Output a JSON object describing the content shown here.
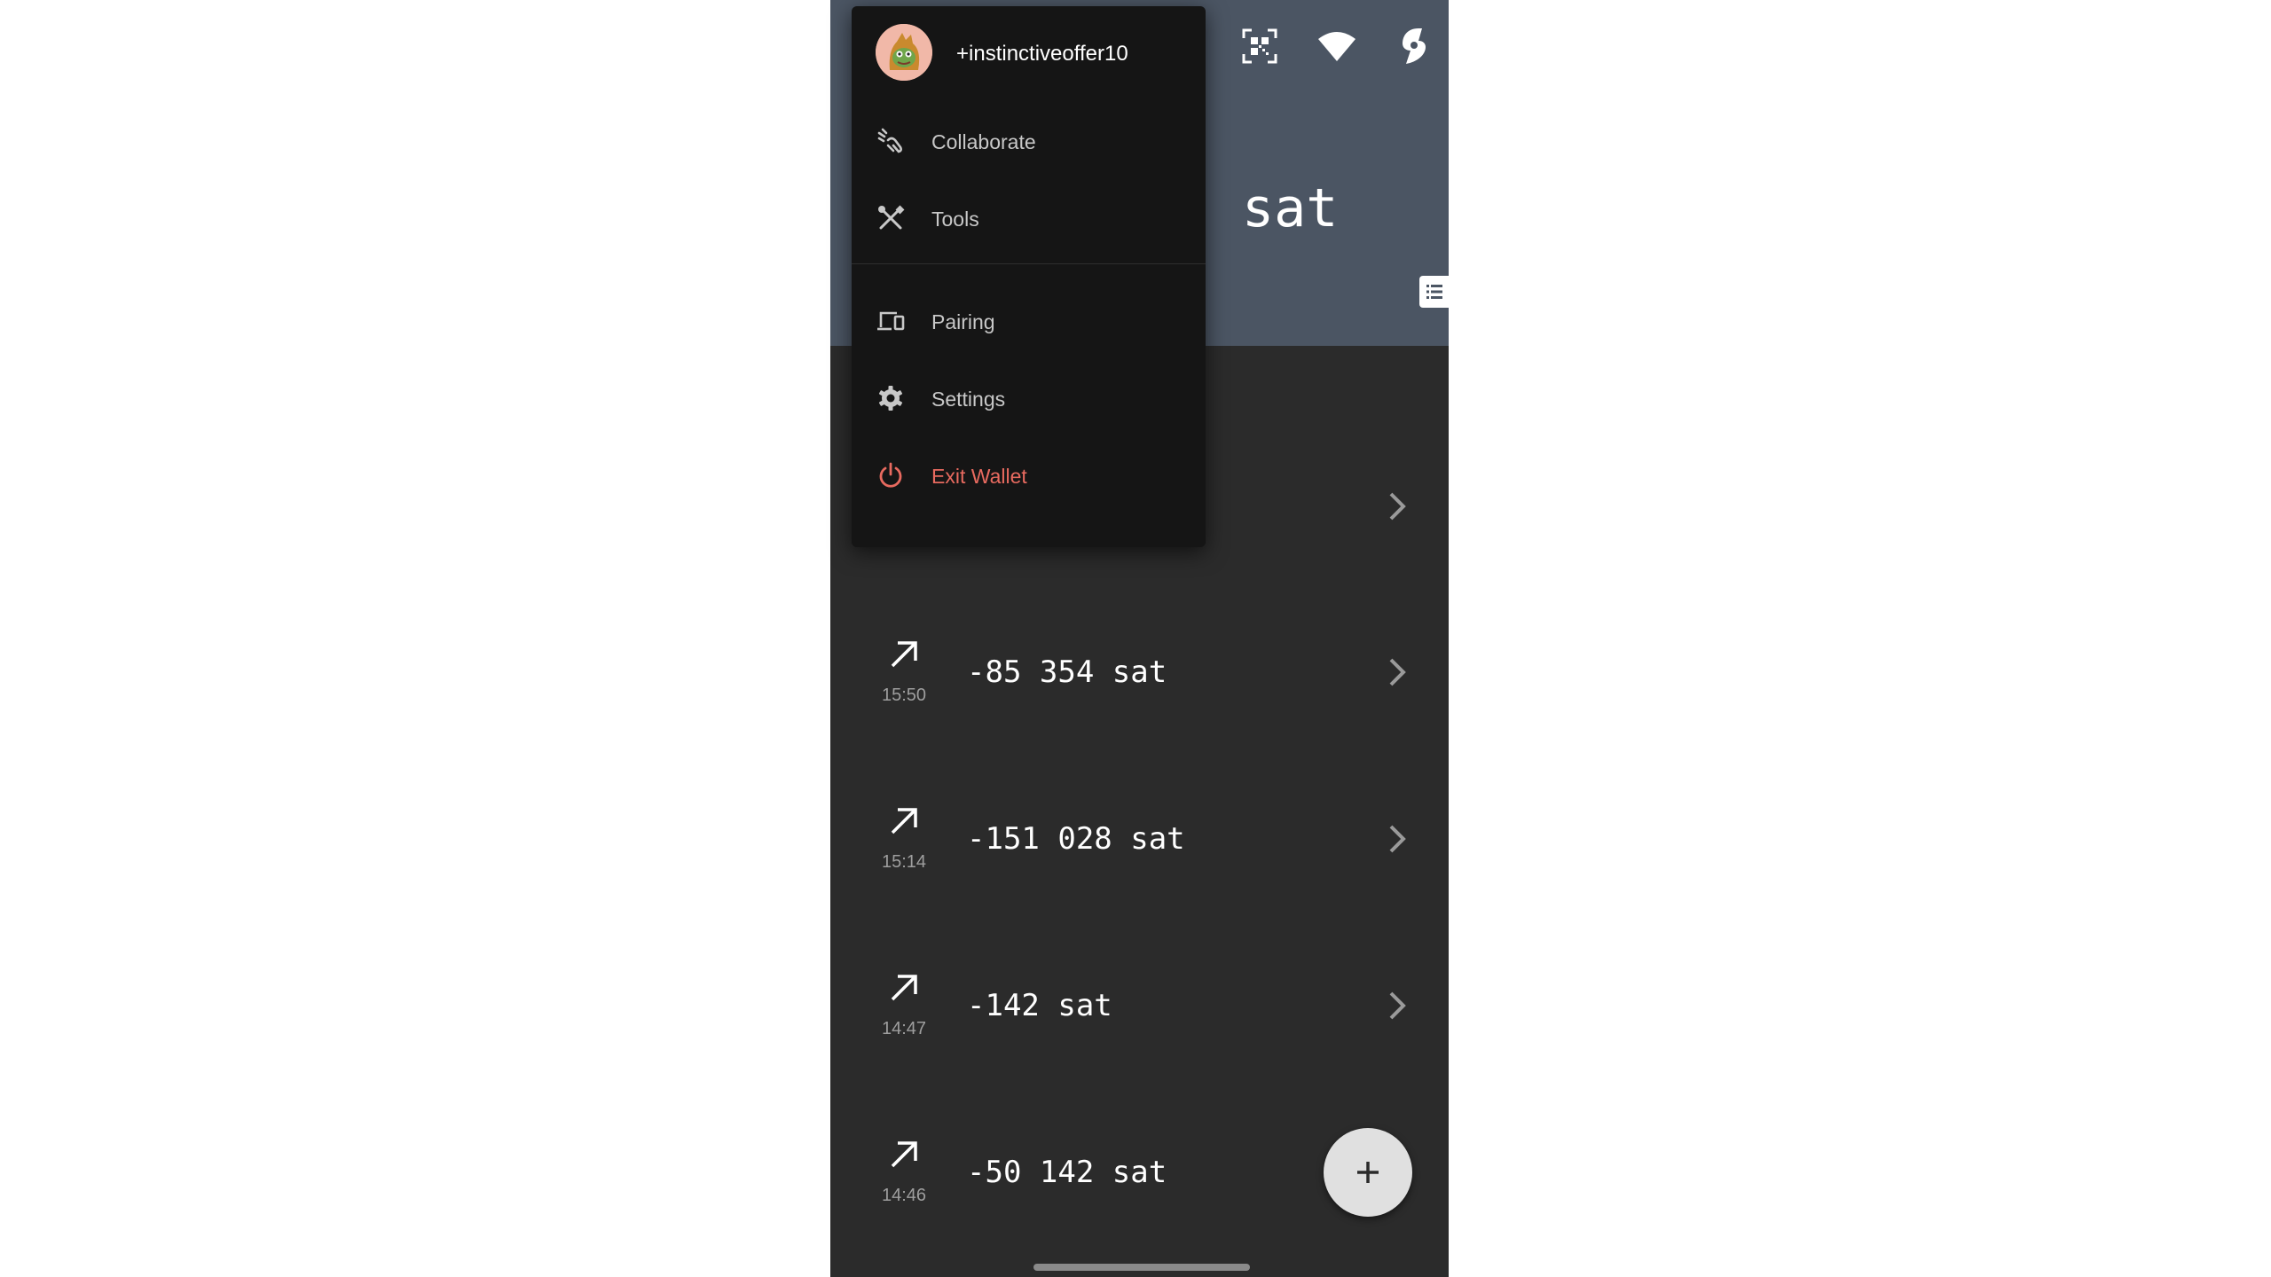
{
  "header": {
    "balance_unit": "sat",
    "icons": [
      "qr-scan-icon",
      "wifi-icon",
      "lightning-icon",
      "list-icon"
    ]
  },
  "transactions": [
    {
      "direction": "outgoing",
      "time": "15:50",
      "amount": "-85 354 sat"
    },
    {
      "direction": "outgoing",
      "time": "15:14",
      "amount": "-151 028 sat"
    },
    {
      "direction": "outgoing",
      "time": "14:47",
      "amount": "-142 sat"
    },
    {
      "direction": "outgoing",
      "time": "14:46",
      "amount": "-50 142 sat"
    }
  ],
  "fab": {
    "icon": "plus-icon"
  },
  "menu": {
    "profile": {
      "name": "+instinctiveoffer10"
    },
    "items": [
      {
        "label": "Collaborate",
        "icon": "collaborate-icon"
      },
      {
        "label": "Tools",
        "icon": "tools-icon"
      },
      {
        "label": "Pairing",
        "icon": "devices-icon"
      },
      {
        "label": "Settings",
        "icon": "gear-icon"
      },
      {
        "label": "Exit Wallet",
        "icon": "power-icon"
      }
    ]
  },
  "colors": {
    "header_bg": "#4b5563",
    "screen_bg": "#2b2b2b",
    "menu_bg": "#151515",
    "danger": "#e86a5f",
    "fab_bg": "#e0e0e0"
  }
}
